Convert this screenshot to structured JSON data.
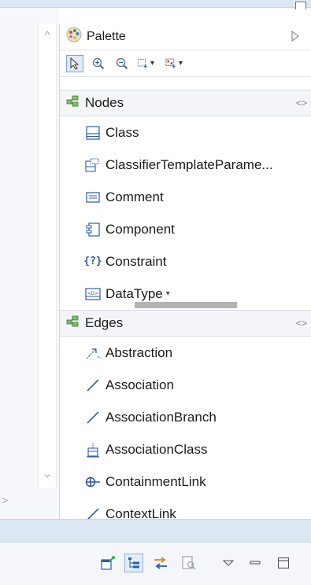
{
  "palette": {
    "title": "Palette",
    "icons": {
      "title": "palette-icon",
      "collapse": "triangle-right-icon"
    }
  },
  "toolbar": {
    "tools": [
      {
        "name": "select-tool",
        "icon": "arrow-pointer-icon"
      },
      {
        "name": "zoom-in-tool",
        "icon": "zoom-in-icon"
      },
      {
        "name": "zoom-out-tool",
        "icon": "zoom-out-icon"
      },
      {
        "name": "marquee-tool",
        "icon": "marquee-icon"
      },
      {
        "name": "connection-tool",
        "icon": "connection-icon"
      }
    ]
  },
  "drawers": {
    "nodes": {
      "label": "Nodes",
      "items": [
        {
          "label": "Class",
          "icon": "class-icon"
        },
        {
          "label": "ClassifierTemplateParame...",
          "icon": "template-parameter-icon"
        },
        {
          "label": "Comment",
          "icon": "comment-icon"
        },
        {
          "label": "Component",
          "icon": "component-icon"
        },
        {
          "label": "Constraint",
          "icon": "constraint-icon"
        },
        {
          "label": "DataType",
          "icon": "datatype-icon"
        }
      ]
    },
    "edges": {
      "label": "Edges",
      "items": [
        {
          "label": "Abstraction",
          "icon": "abstraction-icon"
        },
        {
          "label": "Association",
          "icon": "association-line-icon"
        },
        {
          "label": "AssociationBranch",
          "icon": "association-branch-line-icon"
        },
        {
          "label": "AssociationClass",
          "icon": "association-class-icon"
        },
        {
          "label": "ContainmentLink",
          "icon": "containment-link-icon"
        },
        {
          "label": "ContextLink",
          "icon": "context-link-line-icon"
        }
      ]
    }
  },
  "bottom_toolbar": {
    "buttons": [
      {
        "name": "new-item-button",
        "icon": "new-item-icon"
      },
      {
        "name": "tree-view-button",
        "icon": "tree-icon"
      },
      {
        "name": "link-editor-button",
        "icon": "link-arrows-icon"
      },
      {
        "name": "search-button",
        "icon": "search-doc-icon"
      },
      {
        "name": "view-menu-button",
        "icon": "chevron-down-icon"
      },
      {
        "name": "minimize-button",
        "icon": "minimize-icon"
      },
      {
        "name": "maximize-button",
        "icon": "maximize-icon"
      }
    ]
  },
  "colors": {
    "accent": "#1f5fbf",
    "header_bg": "#dbe7f5",
    "drawer_bg": "#f3f5f8"
  }
}
